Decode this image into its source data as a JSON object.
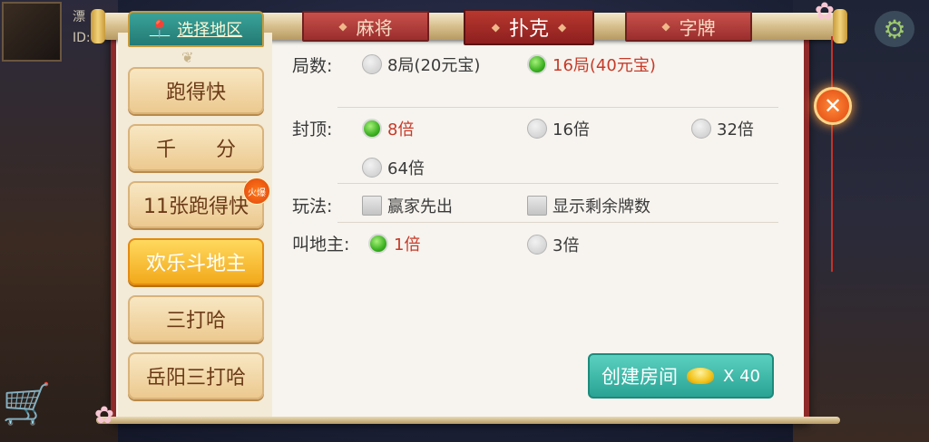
{
  "player": {
    "name": "漂",
    "id_prefix": "ID:"
  },
  "region_button": {
    "label": "选择地区"
  },
  "game_list": [
    {
      "label": "跑得快",
      "active": false
    },
    {
      "label": "千　　分",
      "active": false
    },
    {
      "label": "11张跑得快",
      "active": false,
      "badge": "火爆"
    },
    {
      "label": "欢乐斗地主",
      "active": true
    },
    {
      "label": "三打哈",
      "active": false
    },
    {
      "label": "岳阳三打哈",
      "active": false
    }
  ],
  "tabs": [
    {
      "label": "麻将",
      "active": false
    },
    {
      "label": "扑克",
      "active": true
    },
    {
      "label": "字牌",
      "active": false
    }
  ],
  "form": {
    "rounds": {
      "label": "局数:",
      "options": [
        "8局(20元宝)",
        "16局(40元宝)"
      ],
      "selected": "16局(40元宝)"
    },
    "cap": {
      "label": "封顶:",
      "options": [
        "8倍",
        "16倍",
        "32倍",
        "64倍"
      ],
      "selected": "8倍"
    },
    "rules": {
      "label": "玩法:",
      "options": [
        "赢家先出",
        "显示剩余牌数"
      ],
      "checked": []
    },
    "bid": {
      "label": "叫地主:",
      "options": [
        "1倍",
        "3倍"
      ],
      "selected": "1倍"
    }
  },
  "create_button": {
    "label": "创建房间",
    "cost": "X 40"
  },
  "colors": {
    "accent_teal": "#2aa394",
    "tab_red": "#9a2e2e",
    "selected_text": "#c63a28",
    "radio_green": "#3bb121"
  }
}
